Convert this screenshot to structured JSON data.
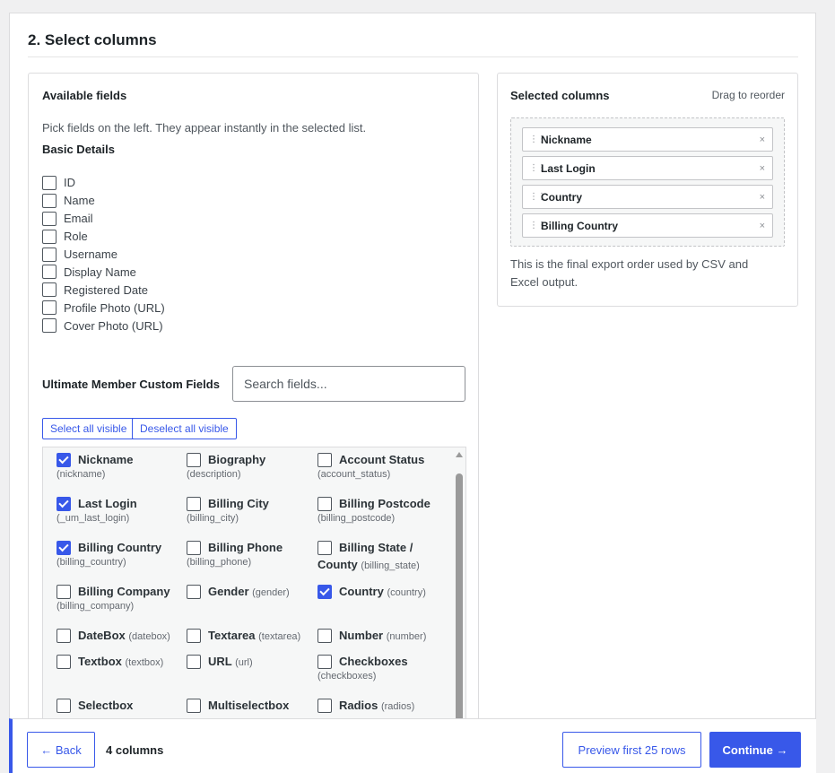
{
  "step_title": "2. Select columns",
  "available": {
    "heading": "Available fields",
    "helper": "Pick fields on the left. They appear instantly in the selected list.",
    "basic_title": "Basic Details",
    "basic_fields": [
      {
        "label": "ID",
        "checked": false
      },
      {
        "label": "Name",
        "checked": false
      },
      {
        "label": "Email",
        "checked": false
      },
      {
        "label": "Role",
        "checked": false
      },
      {
        "label": "Username",
        "checked": false
      },
      {
        "label": "Display Name",
        "checked": false
      },
      {
        "label": "Registered Date",
        "checked": false
      },
      {
        "label": "Profile Photo (URL)",
        "checked": false
      },
      {
        "label": "Cover Photo (URL)",
        "checked": false
      }
    ],
    "custom_title": "Ultimate Member Custom Fields",
    "search_placeholder": "Search fields...",
    "select_all_label": "Select all visible",
    "deselect_all_label": "Deselect all visible",
    "custom_fields": [
      {
        "name": "Nickname",
        "key": "(nickname)",
        "checked": true
      },
      {
        "name": "Biography",
        "key": "(description)",
        "checked": false
      },
      {
        "name": "Account Status",
        "key": "(account_status)",
        "checked": false
      },
      {
        "name": "Last Login",
        "key": "(_um_last_login)",
        "checked": true
      },
      {
        "name": "Billing City",
        "key": "(billing_city)",
        "checked": false
      },
      {
        "name": "Billing Postcode",
        "key": "(billing_postcode)",
        "checked": false
      },
      {
        "name": "Billing Country",
        "key": "(billing_country)",
        "checked": true
      },
      {
        "name": "Billing Phone",
        "key": "(billing_phone)",
        "checked": false
      },
      {
        "name": "Billing State /",
        "name2": "County",
        "key": "(billing_state)",
        "checked": false
      },
      {
        "name": "Billing Company",
        "key": "(billing_company)",
        "checked": false
      },
      {
        "name": "Gender",
        "key": "(gender)",
        "checked": false
      },
      {
        "name": "Country",
        "key": "(country)",
        "checked": true
      },
      {
        "name": "DateBox",
        "key": "(datebox)",
        "checked": false
      },
      {
        "name": "Textarea",
        "key": "(textarea)",
        "checked": false
      },
      {
        "name": "Number",
        "key": "(number)",
        "checked": false
      },
      {
        "name": "Textbox",
        "key": "(textbox)",
        "checked": false
      },
      {
        "name": "URL",
        "key": "(url)",
        "checked": false
      },
      {
        "name": "Checkboxes",
        "key": "(checkboxes)",
        "checked": false
      },
      {
        "name": "Selectbox",
        "key": "",
        "checked": false
      },
      {
        "name": "Multiselectbox",
        "key": "",
        "checked": false
      },
      {
        "name": "Radios",
        "key": "(radios)",
        "checked": false
      }
    ]
  },
  "selected": {
    "heading": "Selected columns",
    "drag_hint": "Drag to reorder",
    "columns": [
      "Nickname",
      "Last Login",
      "Country",
      "Billing Country"
    ],
    "note": "This is the final export order used by CSV and Excel output."
  },
  "footer": {
    "back_label": "← Back",
    "count_label": "4 columns",
    "preview_label": "Preview first 25 rows",
    "continue_label": "Continue →"
  },
  "colors": {
    "accent": "#3858e9"
  }
}
